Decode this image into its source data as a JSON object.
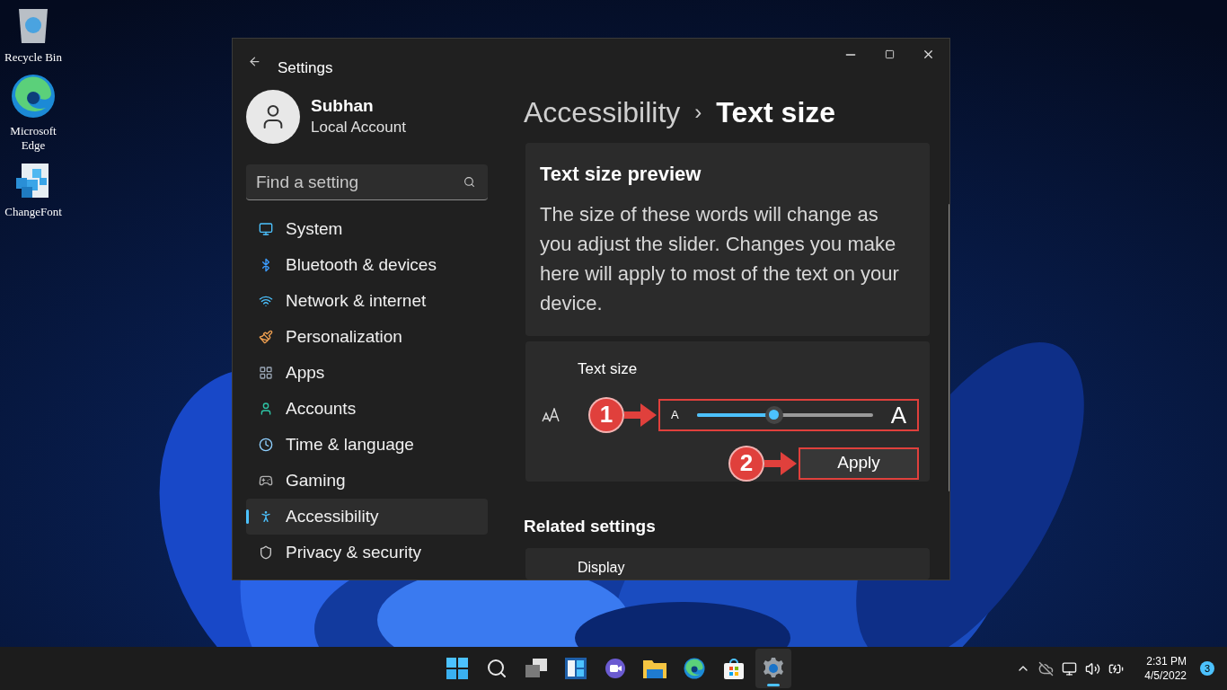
{
  "desktop_icons": [
    {
      "label": "Recycle Bin",
      "kind": "recycle"
    },
    {
      "label": "Microsoft Edge",
      "kind": "edge"
    },
    {
      "label": "ChangeFont",
      "kind": "cubes"
    }
  ],
  "window": {
    "title": "Settings",
    "user": {
      "name": "Subhan",
      "account": "Local Account"
    },
    "search": {
      "placeholder": "Find a setting"
    },
    "nav": [
      {
        "label": "System",
        "kind": "system",
        "selected": false
      },
      {
        "label": "Bluetooth & devices",
        "kind": "bluetooth",
        "selected": false
      },
      {
        "label": "Network & internet",
        "kind": "network",
        "selected": false
      },
      {
        "label": "Personalization",
        "kind": "brush",
        "selected": false
      },
      {
        "label": "Apps",
        "kind": "apps",
        "selected": false
      },
      {
        "label": "Accounts",
        "kind": "accounts",
        "selected": false
      },
      {
        "label": "Time & language",
        "kind": "time",
        "selected": false
      },
      {
        "label": "Gaming",
        "kind": "gaming",
        "selected": false
      },
      {
        "label": "Accessibility",
        "kind": "accessibility",
        "selected": true
      },
      {
        "label": "Privacy & security",
        "kind": "privacy",
        "selected": false
      }
    ],
    "breadcrumb": {
      "parent": "Accessibility",
      "separator": "›",
      "current": "Text size"
    },
    "preview": {
      "title": "Text size preview",
      "text": "The size of these words will change as you adjust the slider. Changes you make here will apply to most of the text on your device."
    },
    "text_size": {
      "label": "Text size",
      "small_glyph": "A",
      "large_glyph": "A",
      "level": 0.44,
      "apply": "Apply"
    },
    "annotations": [
      {
        "number": "1"
      },
      {
        "number": "2"
      }
    ],
    "related": {
      "heading": "Related settings",
      "items": [
        "Display"
      ]
    }
  },
  "taskbar": {
    "apps": [
      {
        "kind": "start",
        "selected": false
      },
      {
        "kind": "search",
        "selected": false
      },
      {
        "kind": "taskview",
        "selected": false
      },
      {
        "kind": "widgets",
        "selected": false
      },
      {
        "kind": "chat",
        "selected": false
      },
      {
        "kind": "explorer",
        "selected": false
      },
      {
        "kind": "edge",
        "selected": false
      },
      {
        "kind": "store",
        "selected": false
      },
      {
        "kind": "settings",
        "selected": true
      }
    ],
    "time": "2:31 PM",
    "date": "4/5/2022",
    "notifications": "3"
  }
}
